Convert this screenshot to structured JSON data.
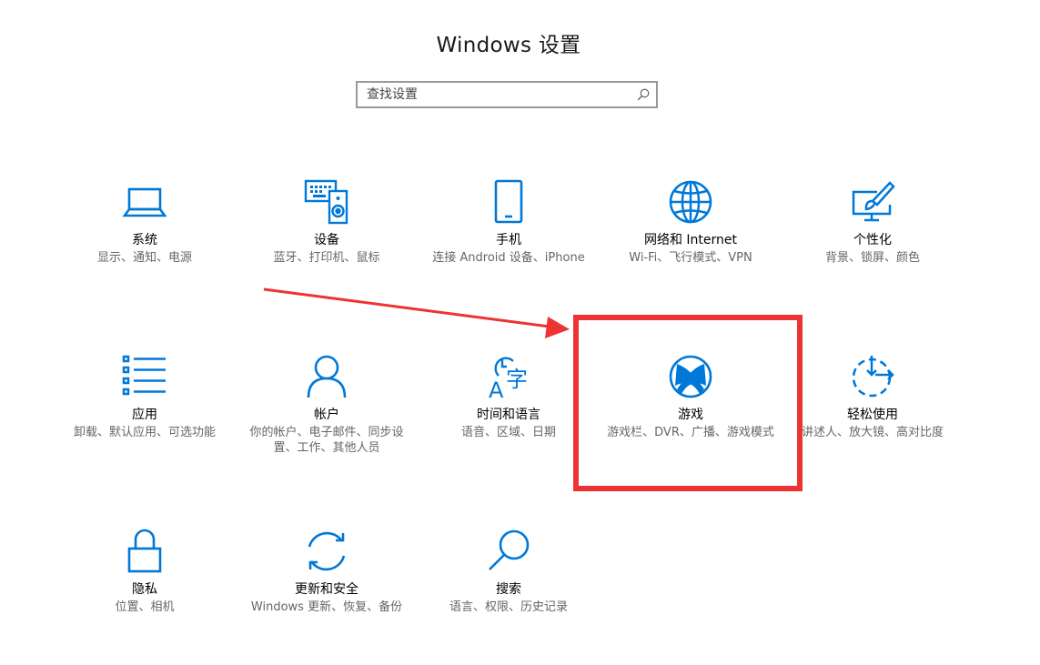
{
  "window": {
    "title": "Windows 设置"
  },
  "search": {
    "placeholder": "查找设置"
  },
  "tiles": [
    {
      "name": "系统",
      "desc": "显示、通知、电源",
      "icon": "laptop-icon"
    },
    {
      "name": "设备",
      "desc": "蓝牙、打印机、鼠标",
      "icon": "keyboard-speaker-icon"
    },
    {
      "name": "手机",
      "desc": "连接 Android 设备、iPhone",
      "icon": "phone-icon"
    },
    {
      "name": "网络和 Internet",
      "desc": "Wi-Fi、飞行模式、VPN",
      "icon": "globe-icon"
    },
    {
      "name": "个性化",
      "desc": "背景、锁屏、颜色",
      "icon": "paint-brush-monitor-icon"
    },
    {
      "name": "应用",
      "desc": "卸载、默认应用、可选功能",
      "icon": "list-icon"
    },
    {
      "name": "帐户",
      "desc": "你的帐户、电子邮件、同步设置、工作、其他人员",
      "icon": "person-icon"
    },
    {
      "name": "时间和语言",
      "desc": "语音、区域、日期",
      "icon": "time-language-icon"
    },
    {
      "name": "游戏",
      "desc": "游戏栏、DVR、广播、游戏模式",
      "icon": "xbox-icon"
    },
    {
      "name": "轻松使用",
      "desc": "讲述人、放大镜、高对比度",
      "icon": "ease-of-access-icon"
    },
    {
      "name": "隐私",
      "desc": "位置、相机",
      "icon": "lock-icon"
    },
    {
      "name": "更新和安全",
      "desc": "Windows 更新、恢复、备份",
      "icon": "sync-icon"
    },
    {
      "name": "搜索",
      "desc": "语言、权限、历史记录",
      "icon": "magnifier-icon"
    }
  ],
  "colors": {
    "accent": "#0078d7",
    "annotation": "#ee3333",
    "description": "#666666"
  }
}
